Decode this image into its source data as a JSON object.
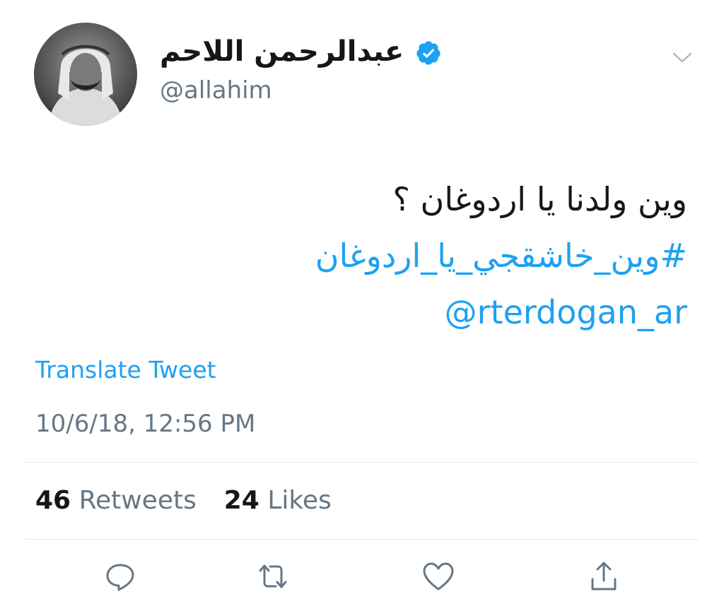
{
  "header": {
    "display_name": "عبدالرحمن اللاحم",
    "handle": "@allahim"
  },
  "tweet": {
    "text": "وين ولدنا يا اردوغان ؟",
    "hashtag": "#وين_خاشقجي_يا_اردوغان",
    "mention": "@rterdogan_ar",
    "translate_label": "Translate Tweet",
    "timestamp": "10/6/18, 12:56 PM"
  },
  "stats": {
    "retweets_count": "46",
    "retweets_label": "Retweets",
    "likes_count": "24",
    "likes_label": "Likes"
  },
  "icons": {
    "verified": "verified-badge-icon",
    "caret": "chevron-down-icon",
    "reply": "reply-icon",
    "retweet": "retweet-icon",
    "like": "heart-icon",
    "share": "share-icon"
  },
  "colors": {
    "accent": "#1da1f2",
    "secondary_text": "#657786",
    "primary_text": "#14171a",
    "divider": "#e1e8ed"
  }
}
